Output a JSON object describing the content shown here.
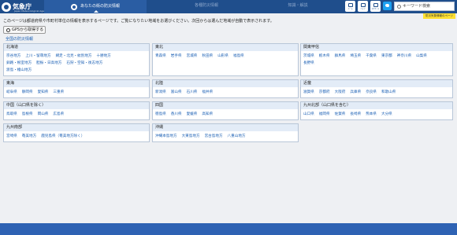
{
  "header": {
    "logo_text": "気象庁",
    "logo_sub": "Japan Meteorological Agency",
    "tabs": [
      {
        "label": "あなたの街の防災情報"
      },
      {
        "label": "各種防災情報"
      },
      {
        "label": "知識・解説"
      }
    ],
    "buttons": [
      {
        "label": "ホーム",
        "icon": "home-icon"
      },
      {
        "label": "ヘルプ",
        "icon": "help-icon"
      },
      {
        "label": "文字サイズ",
        "icon": "text-size-icon"
      }
    ],
    "search_placeholder": "キーワード検索",
    "notice": "防災気象情報のページ"
  },
  "intro_text": "このページは都道府県や市町村単位の情報を表示するページです。ご覧になりたい地域をお選びください。次回からは選んだ地域が自動で表示されます。",
  "gps_button": "GPSから取得する",
  "nation_link": "全国の防災情報",
  "regions": [
    {
      "name": "北海道",
      "items": [
        "宗谷地方",
        "上川・留萌地方",
        "網走・北見・紋別地方",
        "十勝地方",
        "釧路・根室地方",
        "胆振・日高地方",
        "石狩・空知・後志地方",
        "渡島・檜山地方"
      ]
    },
    {
      "name": "東北",
      "items": [
        "青森県",
        "岩手県",
        "宮城県",
        "秋田県",
        "山形県",
        "福島県"
      ]
    },
    {
      "name": "関東甲信",
      "items": [
        "茨城県",
        "栃木県",
        "群馬県",
        "埼玉県",
        "千葉県",
        "東京都",
        "神奈川県",
        "山梨県",
        "長野県"
      ]
    },
    {
      "name": "東海",
      "items": [
        "岐阜県",
        "静岡県",
        "愛知県",
        "三重県"
      ]
    },
    {
      "name": "北陸",
      "items": [
        "新潟県",
        "富山県",
        "石川県",
        "福井県"
      ]
    },
    {
      "name": "近畿",
      "items": [
        "滋賀県",
        "京都府",
        "大阪府",
        "兵庫県",
        "奈良県",
        "和歌山県"
      ]
    },
    {
      "name": "中国（山口県を除く）",
      "items": [
        "鳥取県",
        "島根県",
        "岡山県",
        "広島県"
      ]
    },
    {
      "name": "四国",
      "items": [
        "徳島県",
        "香川県",
        "愛媛県",
        "高知県"
      ]
    },
    {
      "name": "九州北部（山口県を含む）",
      "items": [
        "山口県",
        "福岡県",
        "佐賀県",
        "長崎県",
        "熊本県",
        "大分県"
      ]
    },
    {
      "name": "九州南部",
      "items": [
        "宮崎県",
        "奄美地方",
        "鹿児島県（奄美地方除く）"
      ]
    },
    {
      "name": "沖縄",
      "items": [
        "沖縄本島地方",
        "大東島地方",
        "宮古島地方",
        "八重山地方"
      ]
    }
  ],
  "colors": {
    "header": "#1f4e8c",
    "accent": "#2a5da3",
    "link": "#1a5fb4",
    "notice": "#ffe033",
    "footer": "#2e62b3"
  }
}
